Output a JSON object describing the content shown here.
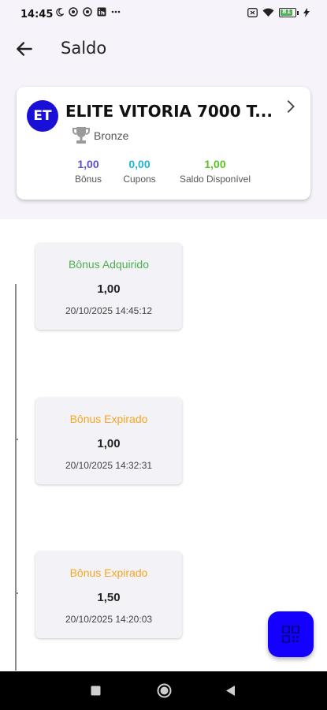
{
  "status_bar": {
    "time": "14:45",
    "battery_level": "81"
  },
  "app_bar": {
    "title": "Saldo"
  },
  "client": {
    "initials": "ET",
    "name": "ELITE VITORIA 7000 T...",
    "tier": "Bronze",
    "stats": [
      {
        "value": "1,00",
        "label": "Bônus",
        "color": "#5a4fd8"
      },
      {
        "value": "0,00",
        "label": "Cupons",
        "color": "#1eb4d8"
      },
      {
        "value": "1,00",
        "label": "Saldo Disponível",
        "color": "#58c322"
      }
    ]
  },
  "transactions": [
    {
      "label": "Bônus Adquirido",
      "amount": "1,00",
      "date": "20/10/2025 14:45:12",
      "color": "#4caf50"
    },
    {
      "label": "Bônus Expirado",
      "amount": "1,00",
      "date": "20/10/2025 14:32:31",
      "color": "#f5a623"
    },
    {
      "label": "Bônus Expirado",
      "amount": "1,50",
      "date": "20/10/2025 14:20:03",
      "color": "#f5a623"
    }
  ],
  "colors": {
    "accent": "#1400ff",
    "avatar": "#1a0fd6"
  }
}
